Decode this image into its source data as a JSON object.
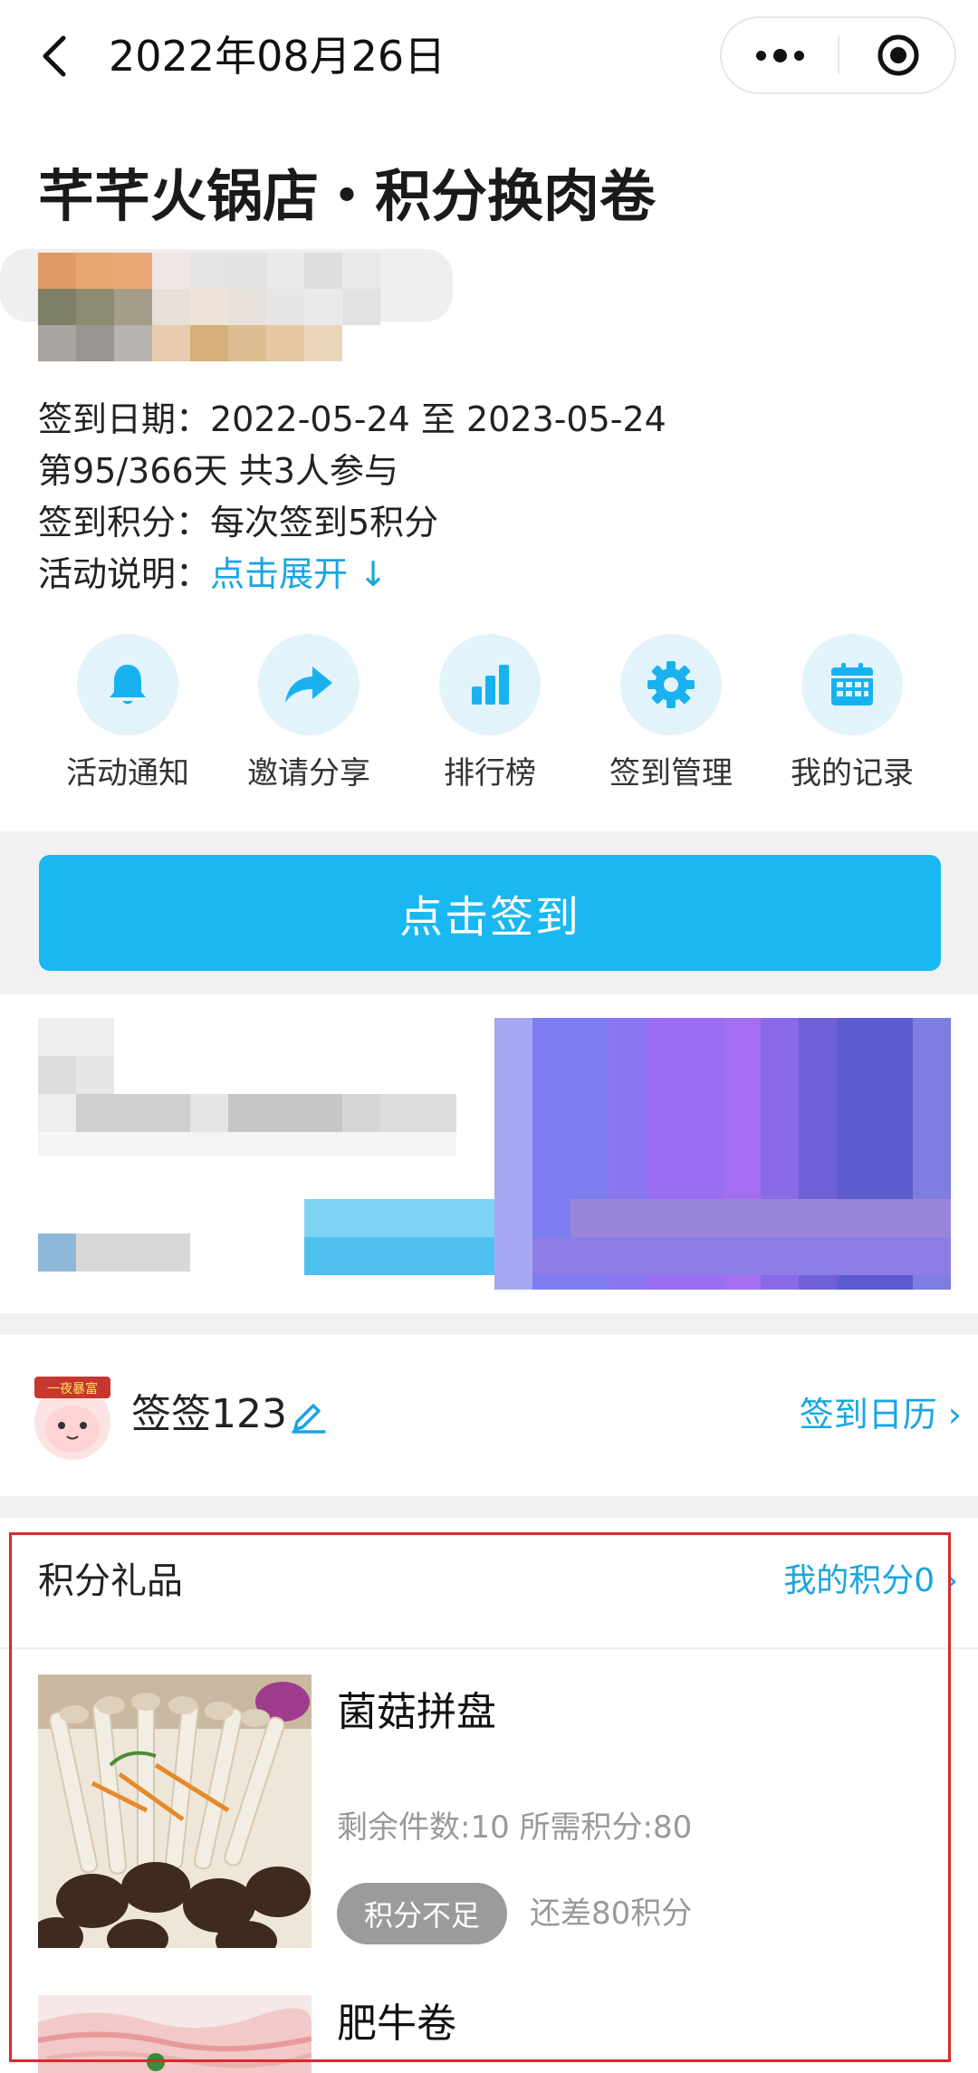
{
  "navbar": {
    "title": "2022年08月26日",
    "back_icon": "chevron-left-icon",
    "more_icon": "more-dots-icon",
    "close_icon": "target-circle-icon"
  },
  "activity": {
    "title": "芊芊火锅店・积分换肉卷",
    "date_line": "签到日期：2022-05-24 至 2023-05-24",
    "progress_line": "第95/366天 共3人参与",
    "points_line": "签到积分：每次签到5积分",
    "desc_label": "活动说明：",
    "desc_link": "点击展开 ↓"
  },
  "actions": [
    {
      "label": "活动通知",
      "icon": "bell-icon"
    },
    {
      "label": "邀请分享",
      "icon": "share-arrow-icon"
    },
    {
      "label": "排行榜",
      "icon": "bar-chart-icon"
    },
    {
      "label": "签到管理",
      "icon": "gear-icon"
    },
    {
      "label": "我的记录",
      "icon": "calendar-icon"
    }
  ],
  "signin_button": "点击签到",
  "user": {
    "name": "签签123",
    "badge_text": "一夜暴富",
    "calendar_link": "签到日历 ›"
  },
  "gifts": {
    "title": "积分礼品",
    "my_points": "我的积分0 ›",
    "items": [
      {
        "name": "菌菇拼盘",
        "meta": "剩余件数:10 所需积分:80",
        "status": "积分不足",
        "diff": "还差80积分"
      },
      {
        "name": "肥牛卷"
      }
    ]
  },
  "colors": {
    "accent": "#1aa5e0",
    "button": "#19b8f0",
    "disabled": "#9b9b9b",
    "highlight_border": "#d92b2b"
  }
}
